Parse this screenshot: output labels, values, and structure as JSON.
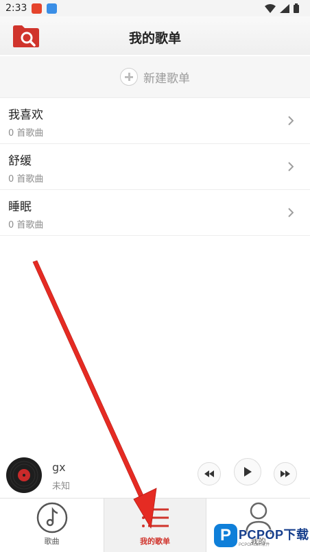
{
  "status_bar": {
    "time": "2:33",
    "icons": [
      "app-notification-icon",
      "gallery-icon",
      "wifi-icon",
      "signal-icon",
      "battery-icon"
    ]
  },
  "header": {
    "title": "我的歌单",
    "logo_icon": "folder-search-icon"
  },
  "new_playlist": {
    "label": "新建歌单",
    "icon": "plus-circle-icon"
  },
  "playlists": [
    {
      "name": "我喜欢",
      "count": "0 首歌曲"
    },
    {
      "name": "舒缓",
      "count": "0 首歌曲"
    },
    {
      "name": "睡眠",
      "count": "0 首歌曲"
    }
  ],
  "player": {
    "title": "gx",
    "artist": "未知",
    "controls": [
      "previous-icon",
      "play-icon",
      "next-icon"
    ]
  },
  "bottom_nav": {
    "tabs": [
      {
        "label": "歌曲",
        "icon": "music-note-icon",
        "active": false
      },
      {
        "label": "我的歌单",
        "icon": "list-icon",
        "active": true
      },
      {
        "label": "我的",
        "icon": "person-icon",
        "active": false
      }
    ]
  },
  "watermark": {
    "badge": "P",
    "text": "PCPOP下载",
    "sub": "PCPOP.com软件"
  },
  "colors": {
    "accent": "#d0342c",
    "annotation_arrow": "#e52b23",
    "header_bg": "#f5f5f5",
    "watermark_blue": "#0f7fd9"
  }
}
